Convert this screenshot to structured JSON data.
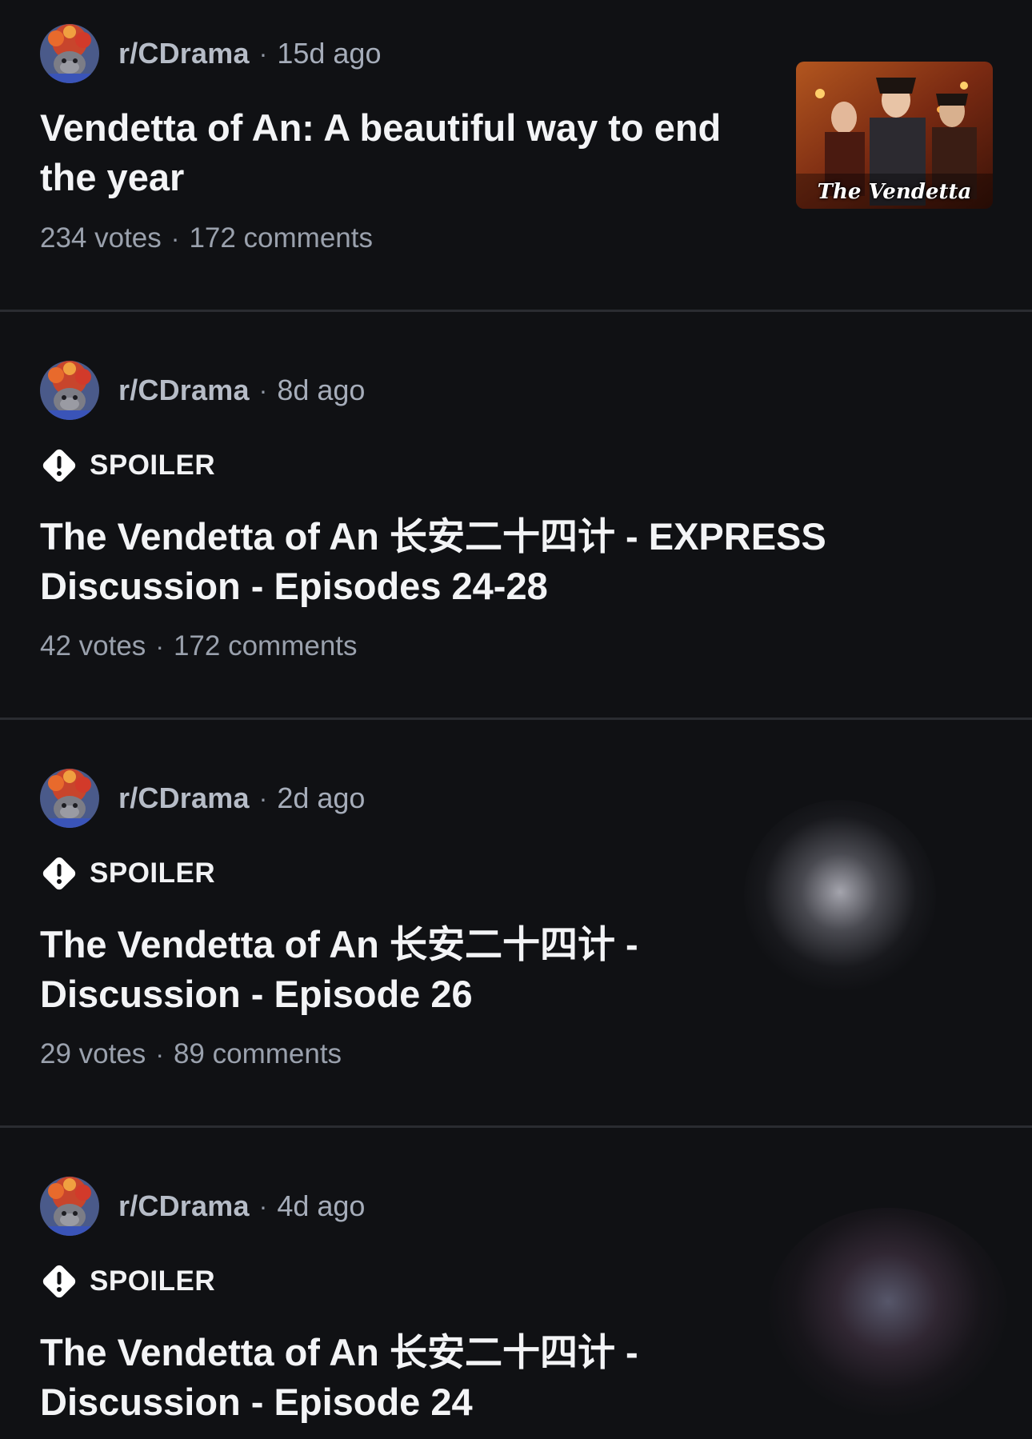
{
  "posts": [
    {
      "subreddit": "r/CDrama",
      "age": "15d ago",
      "spoiler": "",
      "title_line1": "Vendetta of An: A beautiful way to end",
      "title_line2": "the year",
      "votes": "234 votes",
      "comments": "172 comments",
      "thumbnail_caption": "The Vendetta"
    },
    {
      "subreddit": "r/CDrama",
      "age": "8d ago",
      "spoiler": "SPOILER",
      "title_line1": "The Vendetta of An 长安二十四计 - EXPRESS",
      "title_line2": "Discussion - Episodes 24-28",
      "votes": "42 votes",
      "comments": "172 comments"
    },
    {
      "subreddit": "r/CDrama",
      "age": "2d ago",
      "spoiler": "SPOILER",
      "title_line1": "The Vendetta of An 长安二十四计 -",
      "title_line2": "Discussion - Episode 26",
      "votes": "29 votes",
      "comments": "89 comments"
    },
    {
      "subreddit": "r/CDrama",
      "age": "4d ago",
      "spoiler": "SPOILER",
      "title_line1": "The Vendetta of An 长安二十四计 -",
      "title_line2": "Discussion - Episode 24"
    }
  ],
  "separator": "·",
  "icons": {
    "avatar": "subreddit-avatar",
    "spoiler": "warning-diamond-icon"
  },
  "colors": {
    "background": "#101114",
    "divider": "#2a2c31",
    "title": "#f3f4f6",
    "meta": "#a6adba"
  }
}
